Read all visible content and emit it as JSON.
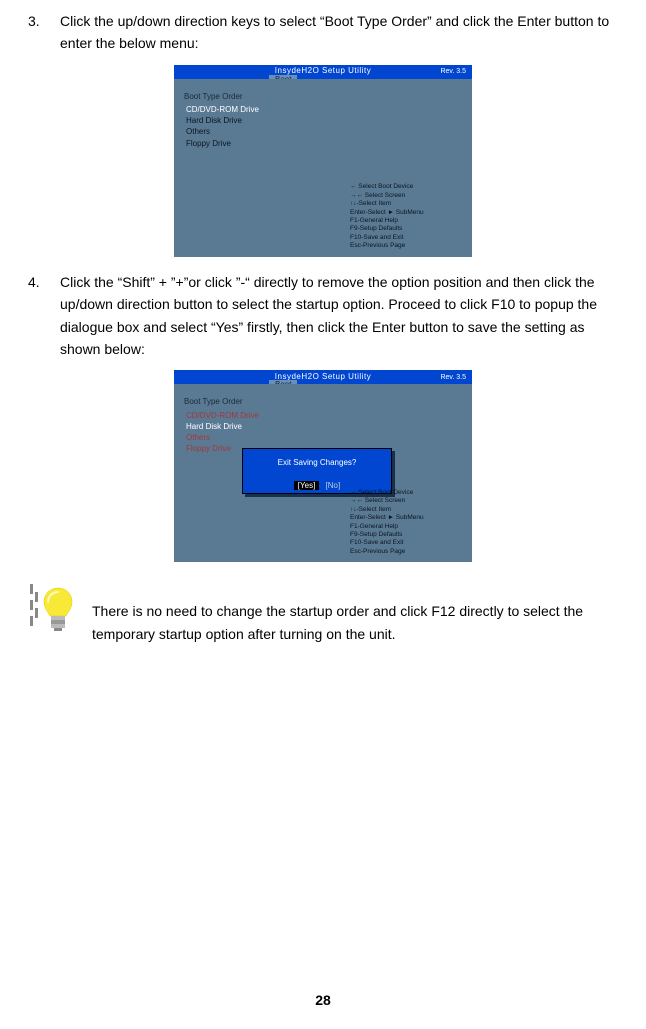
{
  "step3": {
    "num": "3.",
    "text": "Click the up/down direction keys to select “Boot Type Order” and click the Enter button to enter the below menu:"
  },
  "step4": {
    "num": "4.",
    "text": "Click the “Shift” + ”+”or click ”-“ directly to remove the option position and then click the up/down direction button to select the startup option. Proceed to click F10 to popup the dialogue box and select “Yes” firstly, then click the Enter button to save the setting as shown below:"
  },
  "note": {
    "text": "There is no need to change the startup order and click F12 directly to select the temporary startup option after turning on the unit."
  },
  "pageNumber": "28",
  "bios1": {
    "top_title": "InsydeH2O Setup Utility",
    "rev": "Rev. 3.5",
    "tab": "Boot",
    "section": "Boot Type Order",
    "entries": [
      "CD/DVD-ROM Drive",
      "Hard Disk Drive",
      "Others",
      "Floppy Drive"
    ],
    "help": [
      "←        Select Boot Device",
      "→←     Select Screen",
      "↑↓-Select Item",
      "Enter-Select ► SubMenu",
      "F1-General Help",
      "F9-Setup Defaults",
      "F10-Save and Exit",
      "Esc-Previous Page"
    ]
  },
  "bios2": {
    "top_title": "InsydeH2O Setup Utility",
    "rev": "Rev. 3.5",
    "tab": "Boot",
    "section": "Boot Type Order",
    "entries": [
      "CD/DVD-ROM Drive",
      "Hard Disk Drive",
      "Others",
      "Floppy Drive"
    ],
    "dialog_title": "Exit Saving Changes?",
    "dialog_yes": "[Yes]",
    "dialog_no": "[No]",
    "help": [
      "←        Select Boot Device",
      "→←     Select Screen",
      "↑↓-Select Item",
      "Enter-Select ► SubMenu",
      "F1-General Help",
      "F9-Setup Defaults",
      "F10-Save and Exit",
      "Esc-Previous Page"
    ]
  }
}
